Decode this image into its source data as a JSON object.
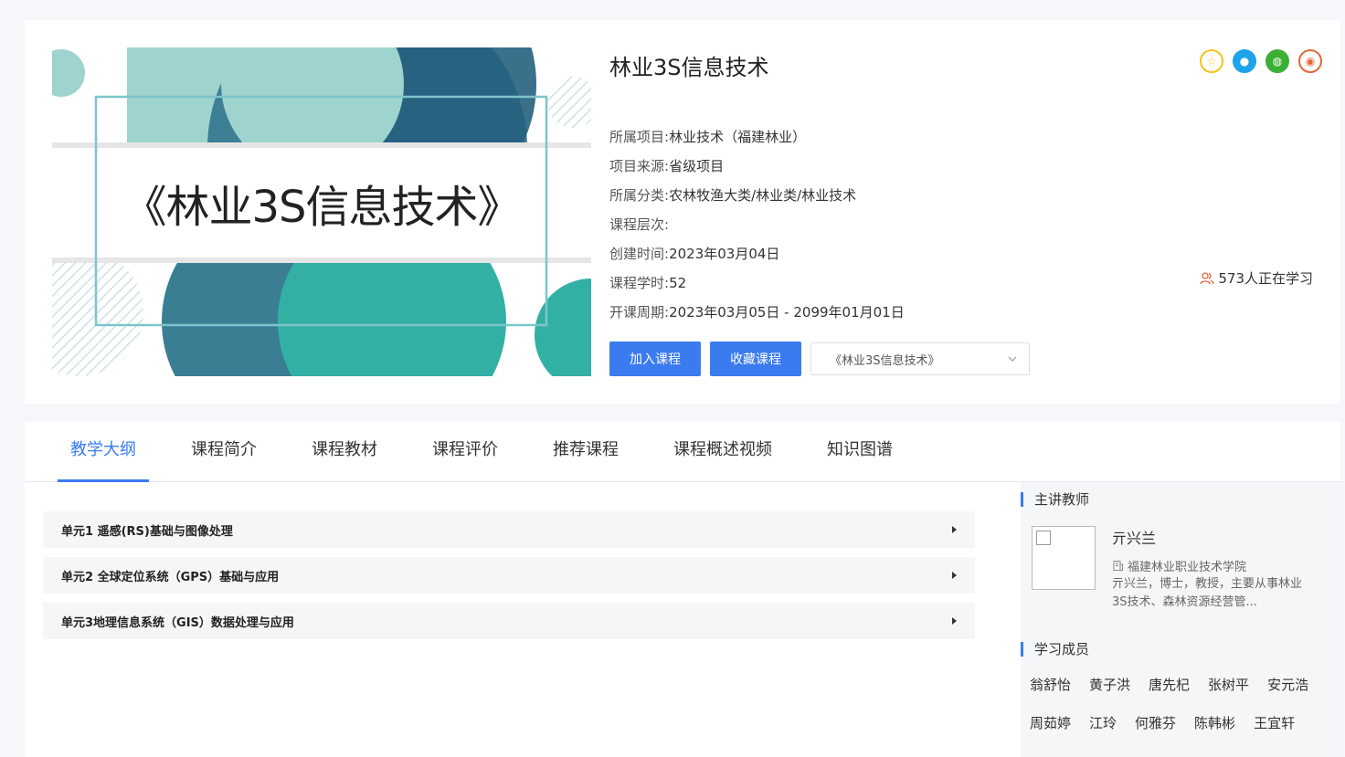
{
  "cover": {
    "title": "《林业3S信息技术》"
  },
  "course": {
    "title": "林业3S信息技术",
    "meta": [
      {
        "label": "所属项目:",
        "value": "林业技术（福建林业）"
      },
      {
        "label": "项目来源:",
        "value": "省级项目"
      },
      {
        "label": "所属分类:",
        "value": "农林牧渔大类/林业类/林业技术"
      },
      {
        "label": "课程层次:",
        "value": ""
      },
      {
        "label": "创建时间:",
        "value": "2023年03月04日"
      },
      {
        "label": "课程学时:",
        "value": "52"
      },
      {
        "label": "开课周期:",
        "value": "2023年03月05日 - 2099年01月01日"
      }
    ],
    "learners": "573人正在学习",
    "join_label": "加入课程",
    "favorite_label": "收藏课程",
    "select_value": "《林业3S信息技术》"
  },
  "share": [
    {
      "icon": "star-icon",
      "color": "#f5c518"
    },
    {
      "icon": "qq-icon",
      "color": "#1fa3e8"
    },
    {
      "icon": "wechat-icon",
      "color": "#3cb035"
    },
    {
      "icon": "weibo-icon",
      "color": "#e8643a"
    }
  ],
  "tabs": [
    "教学大纲",
    "课程简介",
    "课程教材",
    "课程评价",
    "推荐课程",
    "课程概述视频",
    "知识图谱"
  ],
  "units": [
    "单元1 遥感(RS)基础与图像处理",
    "单元2 全球定位系统（GPS）基础与应用",
    "单元3地理信息系统（GIS）数据处理与应用"
  ],
  "sidebar": {
    "teacher_section": "主讲教师",
    "teacher": {
      "name": "亓兴兰",
      "school": "福建林业职业技术学院",
      "desc": "亓兴兰，博士，教授，主要从事林业3S技术、森林资源经营管..."
    },
    "members_section": "学习成员",
    "members": [
      "翁舒怡",
      "黄子洪",
      "唐先杞",
      "张树平",
      "安元浩",
      "周茹婷",
      "江玲",
      "何雅芬",
      "陈韩彬",
      "王宜轩"
    ]
  }
}
